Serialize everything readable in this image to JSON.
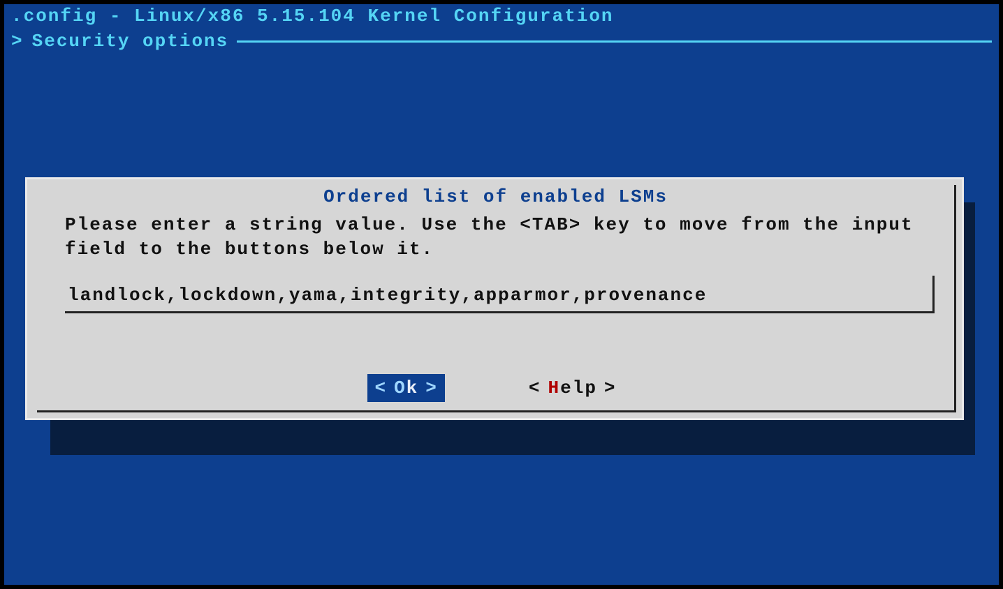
{
  "header": {
    "title": ".config - Linux/x86 5.15.104 Kernel Configuration"
  },
  "breadcrumb": {
    "caret": ">",
    "section": "Security options"
  },
  "dialog": {
    "title": "Ordered list of enabled LSMs",
    "instructions": "Please enter a string value. Use the <TAB> key to move from the input field to the buttons below it.",
    "input_value": "landlock,lockdown,yama,integrity,apparmor,provenance",
    "buttons": {
      "ok": {
        "angle_l": "<",
        "hot": "O",
        "rest": "k",
        "angle_r": ">"
      },
      "help": {
        "angle_l": "<",
        "hot": "H",
        "rest": "elp",
        "angle_r": ">"
      }
    }
  }
}
